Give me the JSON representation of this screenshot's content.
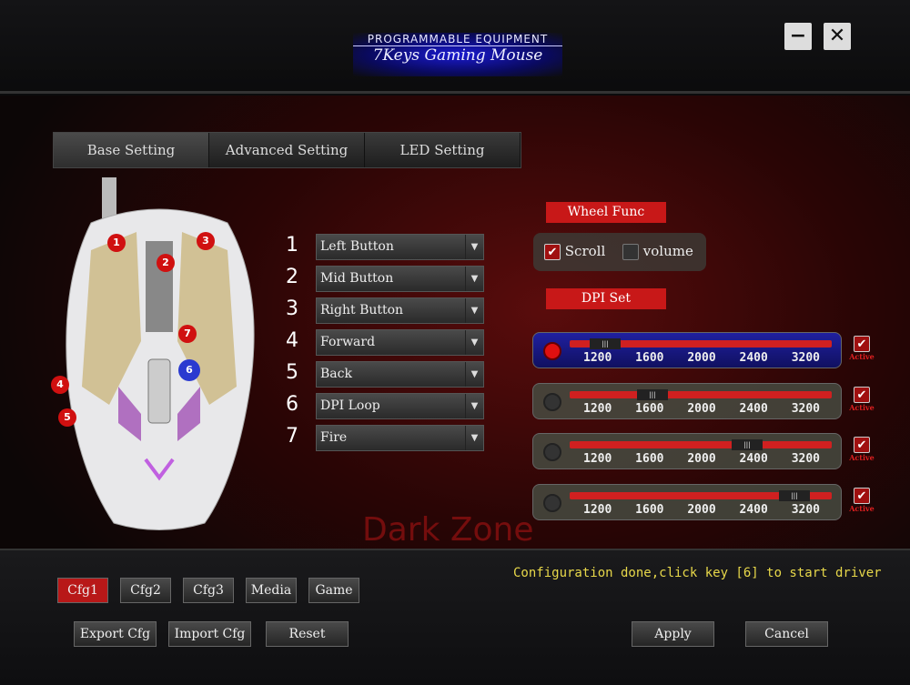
{
  "header": {
    "title_line1": "PROGRAMMABLE EQUIPMENT",
    "title_line2": "7Keys Gaming Mouse",
    "minimize": "−",
    "close": "✕"
  },
  "tabs": [
    {
      "label": "Base Setting",
      "active": true
    },
    {
      "label": "Advanced Setting"
    },
    {
      "label": "LED Setting"
    }
  ],
  "mouse_markers": [
    "1",
    "2",
    "3",
    "4",
    "5",
    "6",
    "7"
  ],
  "buttons": [
    {
      "num": "1",
      "value": "Left Button"
    },
    {
      "num": "2",
      "value": "Mid Button"
    },
    {
      "num": "3",
      "value": "Right Button"
    },
    {
      "num": "4",
      "value": "Forward"
    },
    {
      "num": "5",
      "value": "Back"
    },
    {
      "num": "6",
      "value": "DPI Loop"
    },
    {
      "num": "7",
      "value": "Fire"
    }
  ],
  "wheel": {
    "label": "Wheel Func",
    "scroll": "Scroll",
    "scroll_checked": true,
    "volume": "volume",
    "volume_checked": false
  },
  "dpi": {
    "label": "DPI Set",
    "ticks": [
      "1200",
      "1600",
      "2000",
      "2400",
      "3200"
    ],
    "active_label": "Active",
    "rows": [
      {
        "value": 1200,
        "selected": true,
        "active": true
      },
      {
        "value": 1600,
        "selected": false,
        "active": true
      },
      {
        "value": 2400,
        "selected": false,
        "active": true
      },
      {
        "value": 3200,
        "selected": false,
        "active": true
      }
    ]
  },
  "watermark": "Dark Zone",
  "status": "Configuration done,click key [6] to start driver",
  "cfg": [
    {
      "label": "Cfg1",
      "active": true
    },
    {
      "label": "Cfg2"
    },
    {
      "label": "Cfg3"
    },
    {
      "label": "Media"
    },
    {
      "label": "Game"
    }
  ],
  "actions": {
    "export": "Export Cfg",
    "import": "Import Cfg",
    "reset": "Reset",
    "apply": "Apply",
    "cancel": "Cancel"
  },
  "colors": {
    "accent": "#c81818",
    "status": "#e8d84a",
    "selected_row": "#2020a0"
  }
}
